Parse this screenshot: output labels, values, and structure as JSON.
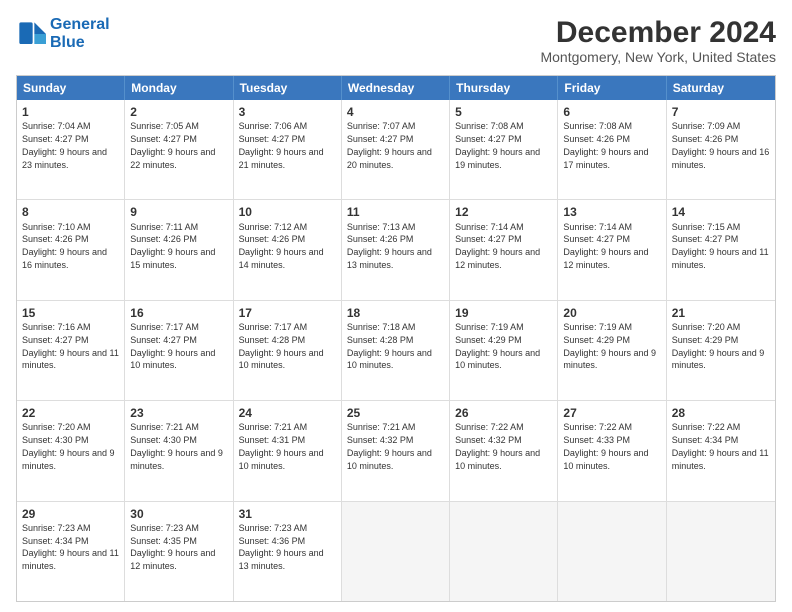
{
  "header": {
    "logo_line1": "General",
    "logo_line2": "Blue",
    "month": "December 2024",
    "location": "Montgomery, New York, United States"
  },
  "weekdays": [
    "Sunday",
    "Monday",
    "Tuesday",
    "Wednesday",
    "Thursday",
    "Friday",
    "Saturday"
  ],
  "weeks": [
    [
      {
        "day": "1",
        "info": "Sunrise: 7:04 AM\nSunset: 4:27 PM\nDaylight: 9 hours and 23 minutes."
      },
      {
        "day": "2",
        "info": "Sunrise: 7:05 AM\nSunset: 4:27 PM\nDaylight: 9 hours and 22 minutes."
      },
      {
        "day": "3",
        "info": "Sunrise: 7:06 AM\nSunset: 4:27 PM\nDaylight: 9 hours and 21 minutes."
      },
      {
        "day": "4",
        "info": "Sunrise: 7:07 AM\nSunset: 4:27 PM\nDaylight: 9 hours and 20 minutes."
      },
      {
        "day": "5",
        "info": "Sunrise: 7:08 AM\nSunset: 4:27 PM\nDaylight: 9 hours and 19 minutes."
      },
      {
        "day": "6",
        "info": "Sunrise: 7:08 AM\nSunset: 4:26 PM\nDaylight: 9 hours and 17 minutes."
      },
      {
        "day": "7",
        "info": "Sunrise: 7:09 AM\nSunset: 4:26 PM\nDaylight: 9 hours and 16 minutes."
      }
    ],
    [
      {
        "day": "8",
        "info": "Sunrise: 7:10 AM\nSunset: 4:26 PM\nDaylight: 9 hours and 16 minutes."
      },
      {
        "day": "9",
        "info": "Sunrise: 7:11 AM\nSunset: 4:26 PM\nDaylight: 9 hours and 15 minutes."
      },
      {
        "day": "10",
        "info": "Sunrise: 7:12 AM\nSunset: 4:26 PM\nDaylight: 9 hours and 14 minutes."
      },
      {
        "day": "11",
        "info": "Sunrise: 7:13 AM\nSunset: 4:26 PM\nDaylight: 9 hours and 13 minutes."
      },
      {
        "day": "12",
        "info": "Sunrise: 7:14 AM\nSunset: 4:27 PM\nDaylight: 9 hours and 12 minutes."
      },
      {
        "day": "13",
        "info": "Sunrise: 7:14 AM\nSunset: 4:27 PM\nDaylight: 9 hours and 12 minutes."
      },
      {
        "day": "14",
        "info": "Sunrise: 7:15 AM\nSunset: 4:27 PM\nDaylight: 9 hours and 11 minutes."
      }
    ],
    [
      {
        "day": "15",
        "info": "Sunrise: 7:16 AM\nSunset: 4:27 PM\nDaylight: 9 hours and 11 minutes."
      },
      {
        "day": "16",
        "info": "Sunrise: 7:17 AM\nSunset: 4:27 PM\nDaylight: 9 hours and 10 minutes."
      },
      {
        "day": "17",
        "info": "Sunrise: 7:17 AM\nSunset: 4:28 PM\nDaylight: 9 hours and 10 minutes."
      },
      {
        "day": "18",
        "info": "Sunrise: 7:18 AM\nSunset: 4:28 PM\nDaylight: 9 hours and 10 minutes."
      },
      {
        "day": "19",
        "info": "Sunrise: 7:19 AM\nSunset: 4:29 PM\nDaylight: 9 hours and 10 minutes."
      },
      {
        "day": "20",
        "info": "Sunrise: 7:19 AM\nSunset: 4:29 PM\nDaylight: 9 hours and 9 minutes."
      },
      {
        "day": "21",
        "info": "Sunrise: 7:20 AM\nSunset: 4:29 PM\nDaylight: 9 hours and 9 minutes."
      }
    ],
    [
      {
        "day": "22",
        "info": "Sunrise: 7:20 AM\nSunset: 4:30 PM\nDaylight: 9 hours and 9 minutes."
      },
      {
        "day": "23",
        "info": "Sunrise: 7:21 AM\nSunset: 4:30 PM\nDaylight: 9 hours and 9 minutes."
      },
      {
        "day": "24",
        "info": "Sunrise: 7:21 AM\nSunset: 4:31 PM\nDaylight: 9 hours and 10 minutes."
      },
      {
        "day": "25",
        "info": "Sunrise: 7:21 AM\nSunset: 4:32 PM\nDaylight: 9 hours and 10 minutes."
      },
      {
        "day": "26",
        "info": "Sunrise: 7:22 AM\nSunset: 4:32 PM\nDaylight: 9 hours and 10 minutes."
      },
      {
        "day": "27",
        "info": "Sunrise: 7:22 AM\nSunset: 4:33 PM\nDaylight: 9 hours and 10 minutes."
      },
      {
        "day": "28",
        "info": "Sunrise: 7:22 AM\nSunset: 4:34 PM\nDaylight: 9 hours and 11 minutes."
      }
    ],
    [
      {
        "day": "29",
        "info": "Sunrise: 7:23 AM\nSunset: 4:34 PM\nDaylight: 9 hours and 11 minutes."
      },
      {
        "day": "30",
        "info": "Sunrise: 7:23 AM\nSunset: 4:35 PM\nDaylight: 9 hours and 12 minutes."
      },
      {
        "day": "31",
        "info": "Sunrise: 7:23 AM\nSunset: 4:36 PM\nDaylight: 9 hours and 13 minutes."
      },
      {
        "day": "",
        "info": ""
      },
      {
        "day": "",
        "info": ""
      },
      {
        "day": "",
        "info": ""
      },
      {
        "day": "",
        "info": ""
      }
    ]
  ]
}
